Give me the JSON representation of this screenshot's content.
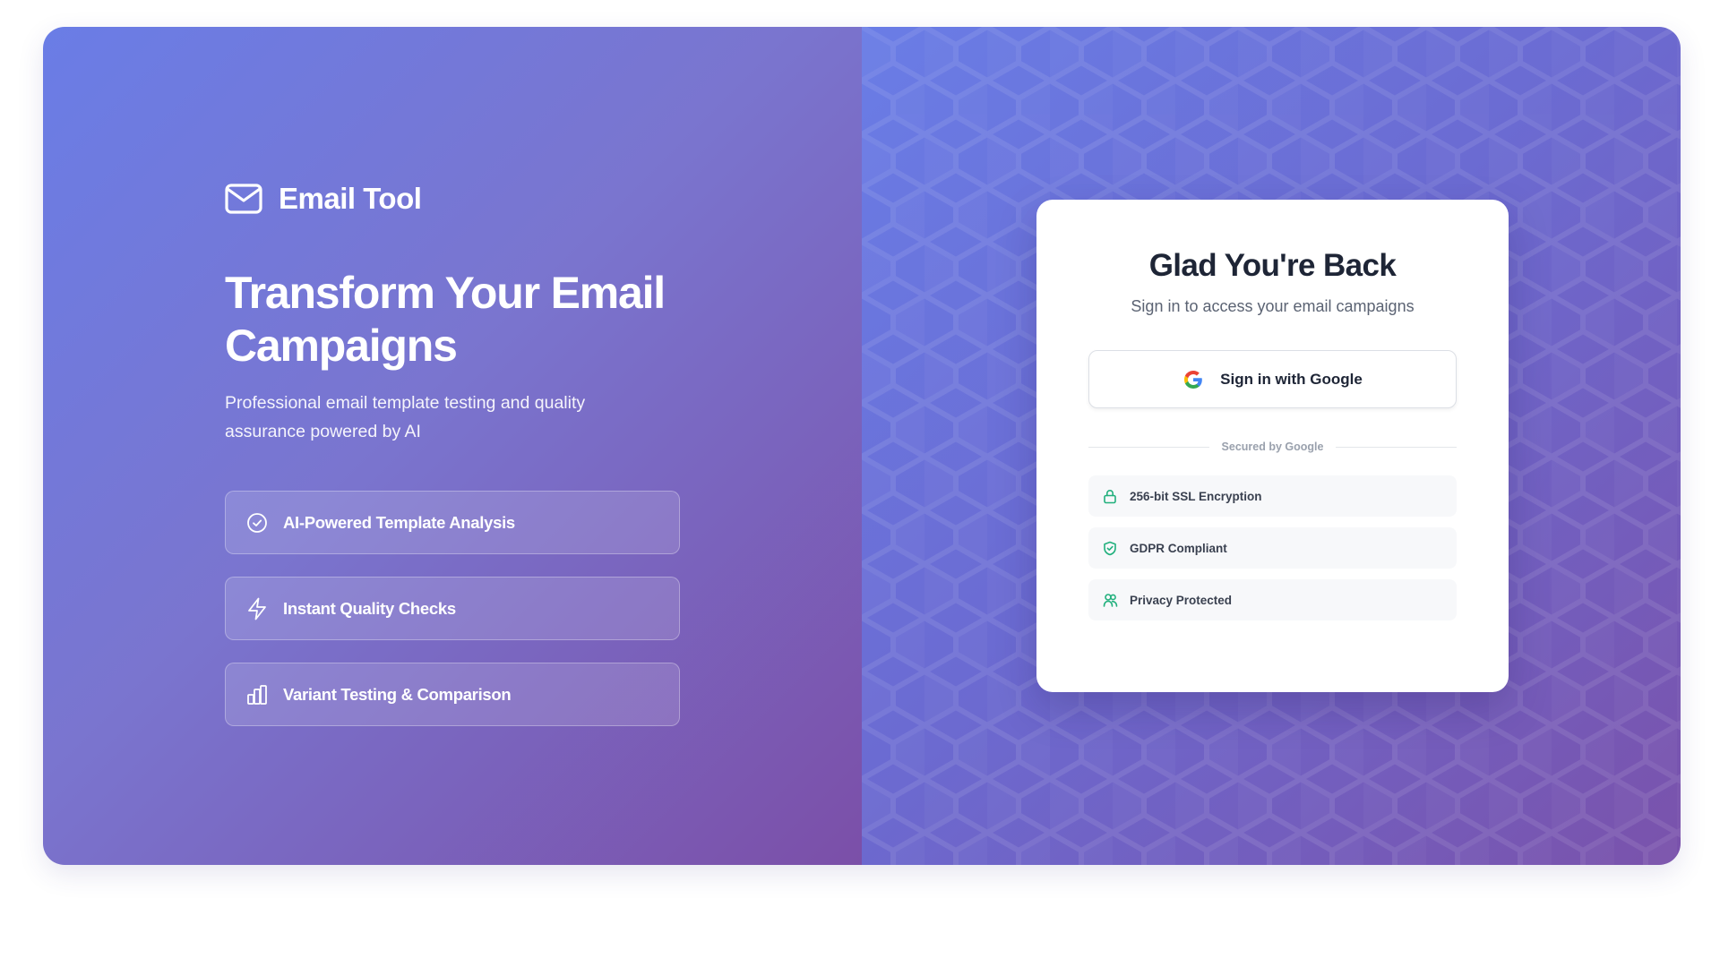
{
  "brand": {
    "name": "Email Tool",
    "icon": "mail-icon"
  },
  "hero": {
    "title": "Transform Your Email Campaigns",
    "subtitle": "Professional email template testing and quality assurance powered by AI"
  },
  "features": [
    {
      "label": "AI-Powered Template Analysis",
      "icon": "check-circle-icon"
    },
    {
      "label": "Instant Quality Checks",
      "icon": "lightning-icon"
    },
    {
      "label": "Variant Testing & Comparison",
      "icon": "bar-chart-icon"
    }
  ],
  "card": {
    "title": "Glad You're Back",
    "subtitle": "Sign in to access your email campaigns",
    "google_button_label": "Sign in with Google",
    "divider_text": "Secured by Google",
    "badges": [
      {
        "label": "256-bit SSL Encryption",
        "icon": "lock-icon"
      },
      {
        "label": "GDPR Compliant",
        "icon": "shield-check-icon"
      },
      {
        "label": "Privacy Protected",
        "icon": "users-icon"
      }
    ]
  },
  "colors": {
    "accent_gradient_start": "#6a7de6",
    "accent_gradient_end": "#7b4fa8",
    "badge_icon": "#22b07d",
    "text_dark": "#1e2536"
  }
}
